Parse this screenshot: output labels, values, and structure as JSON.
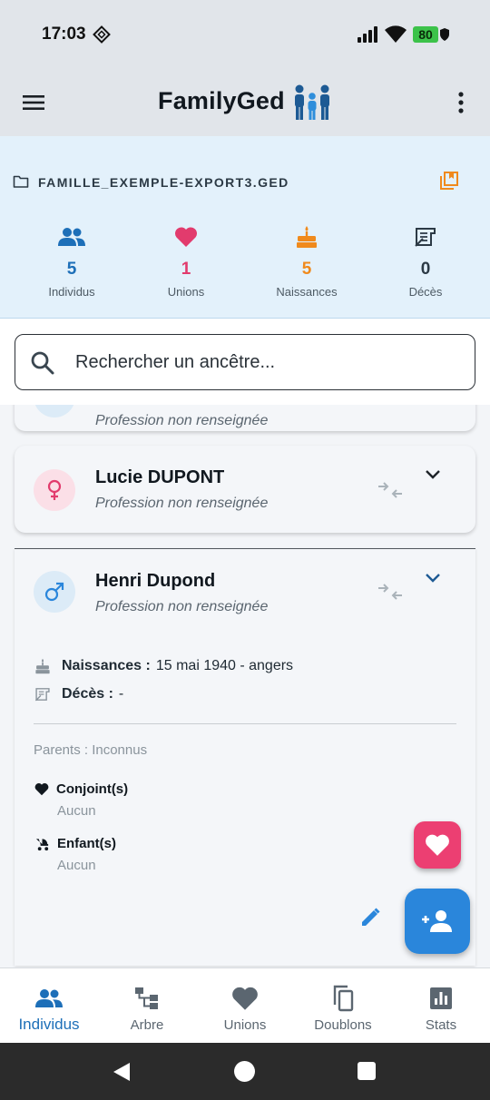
{
  "status": {
    "time": "17:03",
    "battery": "80"
  },
  "app": {
    "title": "FamilyGed"
  },
  "file": {
    "name": "FAMILLE_EXEMPLE-EXPORT3.GED"
  },
  "stats": [
    {
      "icon": "people-icon",
      "value": "5",
      "label": "Individus",
      "color": "#1d6fb8"
    },
    {
      "icon": "heart-icon",
      "value": "1",
      "label": "Unions",
      "color": "#e23b6d"
    },
    {
      "icon": "cake-icon",
      "value": "5",
      "label": "Naissances",
      "color": "#f08a1c"
    },
    {
      "icon": "grave-icon",
      "value": "0",
      "label": "Décès",
      "color": "#2c3a45"
    }
  ],
  "search": {
    "placeholder": "Rechercher un ancêtre..."
  },
  "persons": [
    {
      "name": "",
      "job": "Profession non renseignée",
      "gender": "male"
    },
    {
      "name": "Lucie DUPONT",
      "job": "Profession non renseignée",
      "gender": "female"
    },
    {
      "name": "Henri Dupond",
      "job": "Profession non renseignée",
      "gender": "male",
      "birth_label": "Naissances :",
      "birth_value": "15 mai 1940 - angers",
      "death_label": "Décès :",
      "death_value": "-",
      "parents": "Parents : Inconnus",
      "spouses_label": "Conjoint(s)",
      "spouses_value": "Aucun",
      "children_label": "Enfant(s)",
      "children_value": "Aucun"
    }
  ],
  "nav": [
    {
      "icon": "people-icon",
      "label": "Individus",
      "active": true
    },
    {
      "icon": "tree-icon",
      "label": "Arbre"
    },
    {
      "icon": "heart-icon",
      "label": "Unions"
    },
    {
      "icon": "copy-icon",
      "label": "Doublons"
    },
    {
      "icon": "chart-icon",
      "label": "Stats"
    }
  ],
  "colors": {
    "accent": "#1d6fb8",
    "pink": "#ec3f72",
    "fab_blue": "#2a86db",
    "panel": "#e3f1fb"
  }
}
